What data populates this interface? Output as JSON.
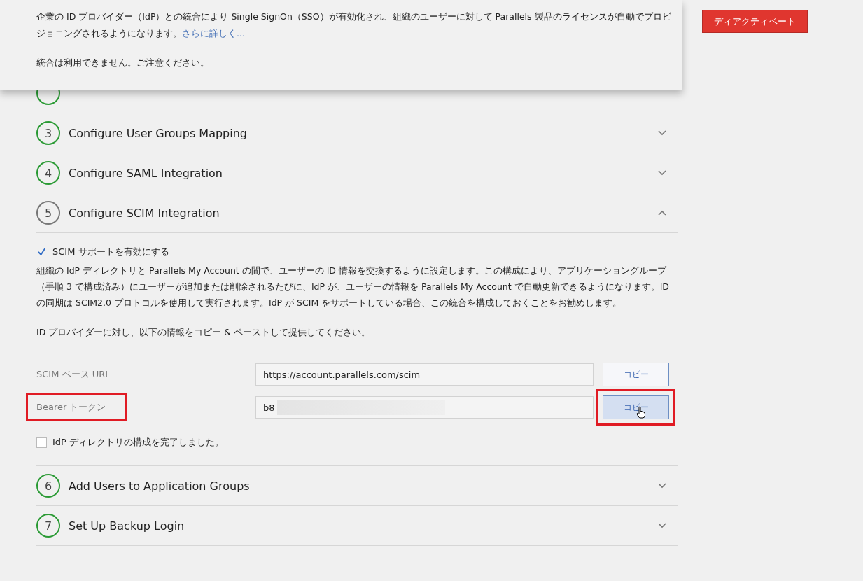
{
  "banner": {
    "text": "企業の ID プロバイダー（IdP）との統合により Single SignOn（SSO）が有効化され、組織のユーザーに対して Parallels 製品のライセンスが自動でプロビジョニングされるようになります。",
    "link": "さらに詳しく...",
    "notice": "統合は利用できません。ご注意ください。"
  },
  "deactivate_button": "ディアクティベート",
  "steps": [
    {
      "completed": true
    },
    {
      "number": "3",
      "title": "Configure User Groups Mapping",
      "completed": true,
      "expanded": false
    },
    {
      "number": "4",
      "title": "Configure SAML Integration",
      "completed": true,
      "expanded": false
    },
    {
      "number": "5",
      "title": "Configure SCIM Integration",
      "completed": false,
      "expanded": true
    },
    {
      "number": "6",
      "title": "Add Users to Application Groups",
      "completed": true,
      "expanded": false
    },
    {
      "number": "7",
      "title": "Set Up Backup Login",
      "completed": true,
      "expanded": false
    }
  ],
  "scim": {
    "enable": {
      "label": "SCIM サポートを有効にする",
      "checked": true
    },
    "description": "組織の IdP ディレクトリと Parallels My Account の間で、ユーザーの ID 情報を交換するように設定します。この構成により、アプリケーショングループ（手順 3 で構成済み）にユーザーが追加または削除されるたびに、IdP が、ユーザーの情報を Parallels My Account で自動更新できるようになります。ID の同期は SCIM2.0 プロトコルを使用して実行されます。IdP が SCIM をサポートしている場合、この統合を構成しておくことをお勧めします。",
    "instruction": "ID プロバイダーに対し、以下の情報をコピー & ペーストして提供してください。",
    "fields": [
      {
        "label": "SCIM ベース URL",
        "value": "https://account.parallels.com/scim",
        "button": "コピー",
        "highlighted": false,
        "hovered": false
      },
      {
        "label": "Bearer トークン",
        "value": "b8",
        "button": "コピー",
        "highlighted": true,
        "hovered": true
      }
    ],
    "done": {
      "label": "IdP ディレクトリの構成を完了しました。",
      "checked": false
    }
  }
}
